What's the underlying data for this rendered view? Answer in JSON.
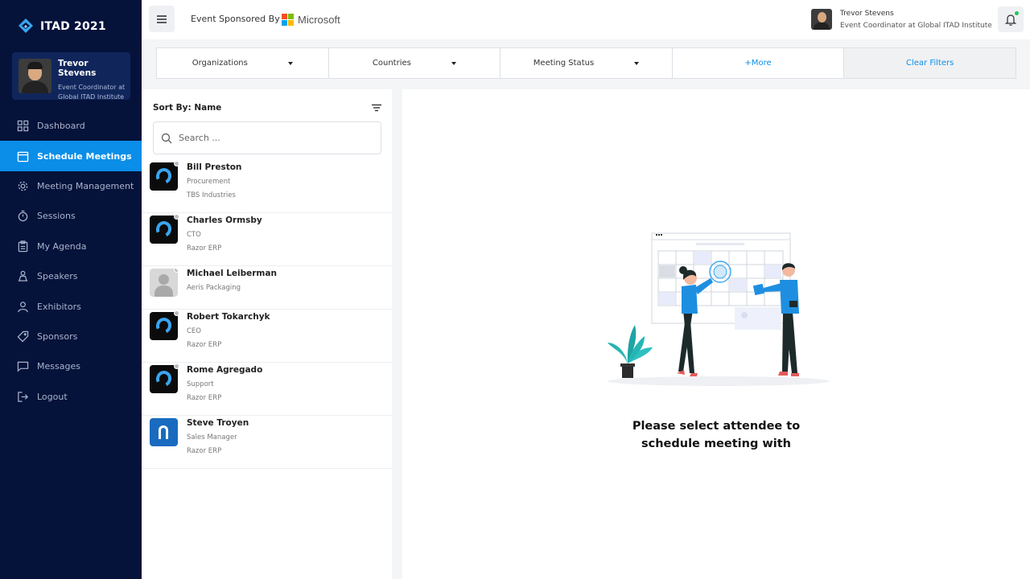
{
  "app": {
    "title": "ITAD 2021"
  },
  "profile": {
    "name": "Trevor Stevens",
    "role": "Event Coordinator at Global ITAD Institute"
  },
  "nav": {
    "items": [
      {
        "label": "Dashboard",
        "icon": "dashboard-icon"
      },
      {
        "label": "Schedule Meetings",
        "icon": "calendar-icon"
      },
      {
        "label": "Meeting Management",
        "icon": "gear-icon"
      },
      {
        "label": "Sessions",
        "icon": "stopwatch-icon"
      },
      {
        "label": "My Agenda",
        "icon": "clipboard-icon"
      },
      {
        "label": "Speakers",
        "icon": "speaker-icon"
      },
      {
        "label": "Exhibitors",
        "icon": "user-icon"
      },
      {
        "label": "Sponsors",
        "icon": "tag-icon"
      },
      {
        "label": "Messages",
        "icon": "message-icon"
      },
      {
        "label": "Logout",
        "icon": "logout-icon"
      }
    ],
    "active_index": 1
  },
  "topbar": {
    "sponsor_text": "Event Sponsored By",
    "sponsor_name": "Microsoft",
    "user_name": "Trevor Stevens",
    "user_role": "Event Coordinator at Global ITAD Institute"
  },
  "filters": {
    "organizations": "Organizations",
    "countries": "Countries",
    "meeting_status": "Meeting Status",
    "more": "+More",
    "clear": "Clear Filters"
  },
  "list": {
    "sort_label": "Sort By: Name",
    "search_placeholder": "Search ...",
    "attendees": [
      {
        "name": "Bill Preston",
        "role": "Procurement",
        "company": "TBS Industries"
      },
      {
        "name": "Charles Ormsby",
        "role": "CTO",
        "company": "Razor ERP"
      },
      {
        "name": "Michael Leiberman",
        "role": "Aeris Packaging"
      },
      {
        "name": "Robert Tokarchyk",
        "role": "CEO",
        "company": "Razor ERP"
      },
      {
        "name": "Rome Agregado",
        "role": "Support",
        "company": "Razor ERP"
      },
      {
        "name": "Steve Troyen",
        "role": "Sales Manager",
        "company": "Razor ERP"
      }
    ]
  },
  "main": {
    "prompt": "Please select attendee to schedule meeting with"
  },
  "colors": {
    "sidebar": "#05123a",
    "accent": "#0a8ee8",
    "card": "#10265b"
  }
}
